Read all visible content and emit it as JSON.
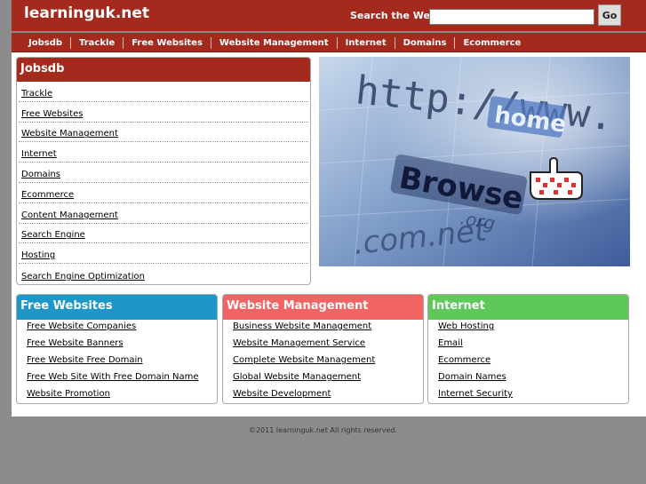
{
  "header": {
    "site_title": "learninguk.net",
    "search_label": "Search the Web:",
    "search_value": "",
    "go_label": "Go"
  },
  "nav": [
    "Jobsdb",
    "Trackle",
    "Free Websites",
    "Website Management",
    "Internet",
    "Domains",
    "Ecommerce"
  ],
  "main_box": {
    "title": "Jobsdb",
    "links": [
      "Trackle",
      "Free Websites",
      "Website Management",
      "Internet",
      "Domains",
      "Ecommerce",
      "Content Management",
      "Search Engine",
      "Hosting",
      "Search Engine Optimization"
    ]
  },
  "hero": {
    "text_http": "http://www.",
    "text_home": "home",
    "text_browse": "Browse",
    "text_org": ".org",
    "text_comnet": ".com.net"
  },
  "columns": [
    {
      "title": "Free Websites",
      "color": "#1f96c8",
      "links": [
        "Free Website Companies",
        "Free Website Banners",
        "Free Website Free Domain",
        "Free Web Site With Free Domain Name",
        "Website Promotion"
      ]
    },
    {
      "title": "Website Management",
      "color": "#f06464",
      "links": [
        "Business Website Management",
        "Website Management Service",
        "Complete Website Management",
        "Global Website Management",
        "Website Development"
      ]
    },
    {
      "title": "Internet",
      "color": "#5ec85a",
      "links": [
        "Web Hosting",
        "Email",
        "Ecommerce",
        "Domain Names",
        "Internet Security"
      ]
    }
  ],
  "footer": {
    "copyright": "©2011 learninguk.net All rights reserved."
  },
  "colors": {
    "brand": "#a52a1e",
    "background": "#8c8c8c"
  }
}
